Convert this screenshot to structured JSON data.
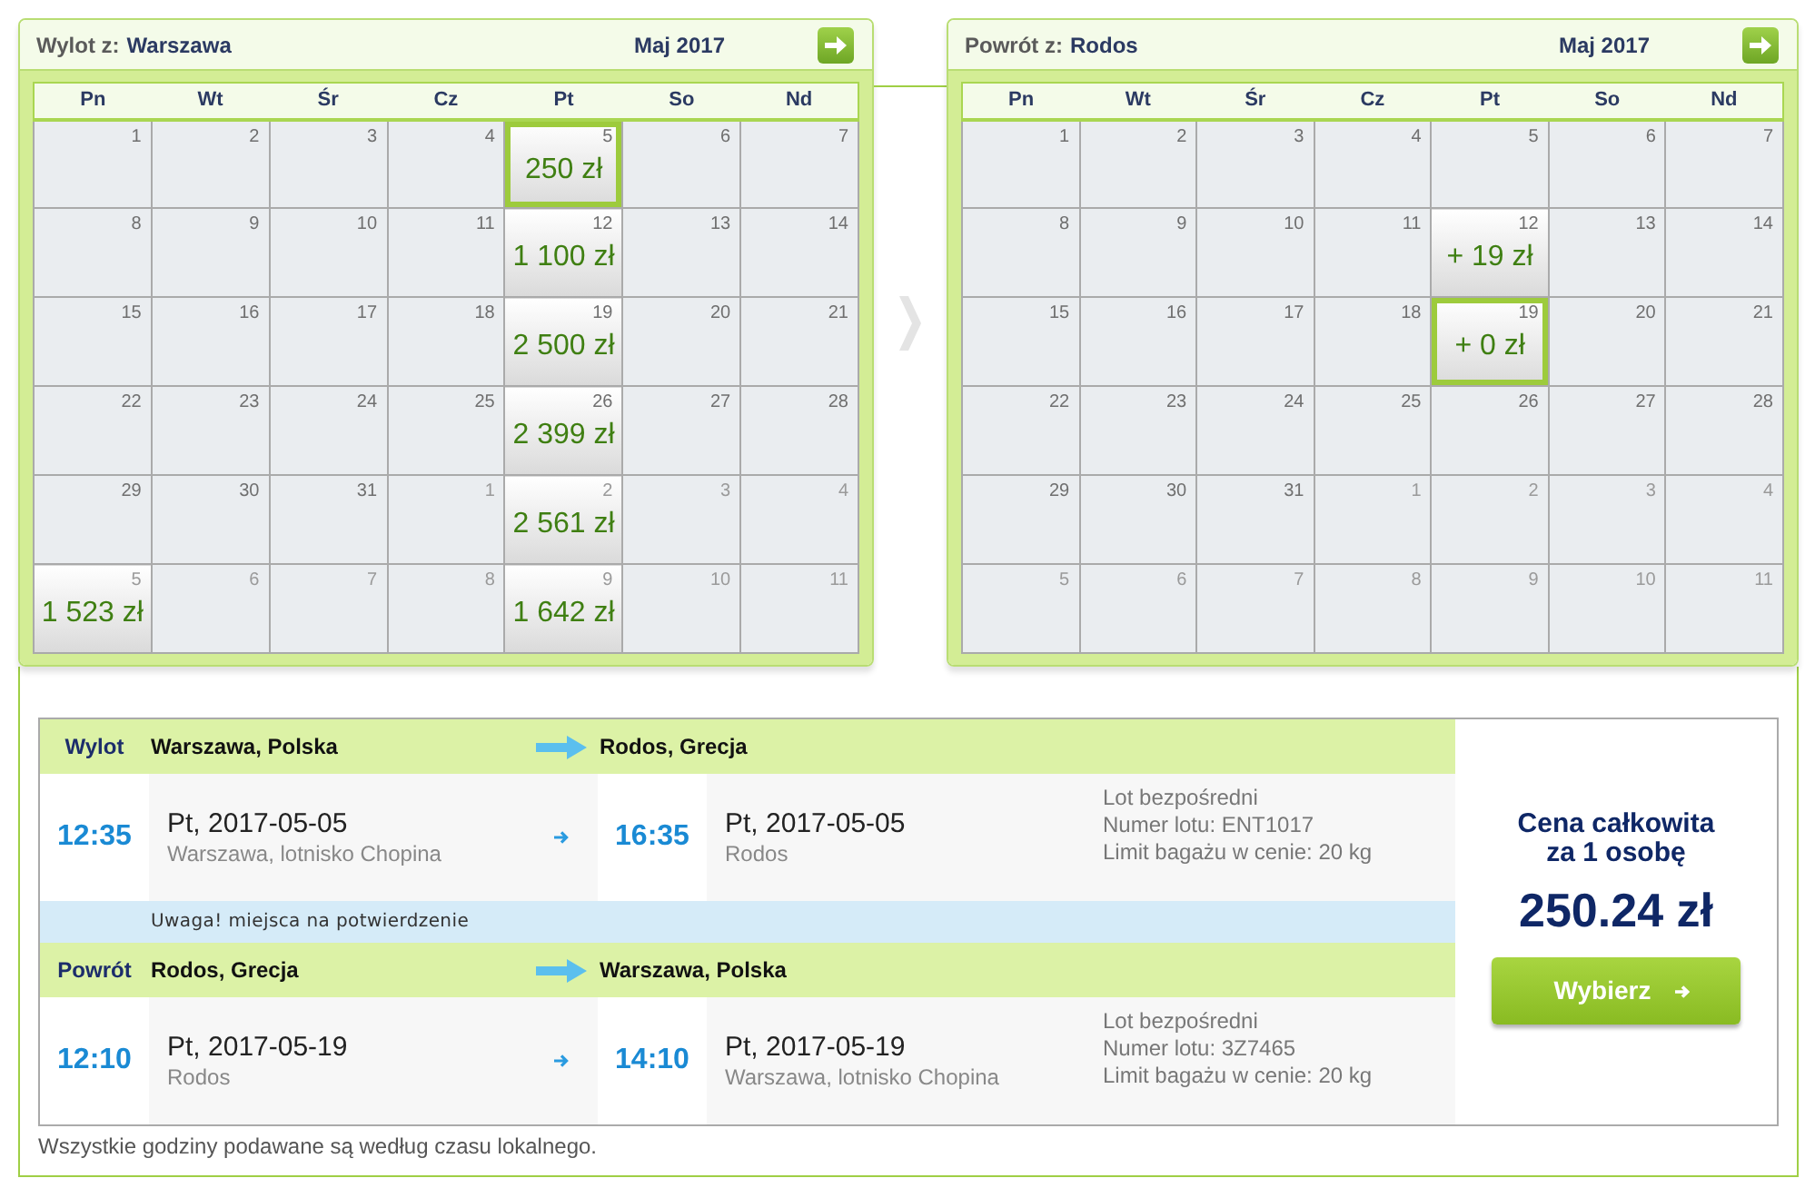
{
  "calendars": [
    {
      "label": "Wylot z:",
      "city": "Warszawa",
      "month": "Maj 2017",
      "weekdays": [
        "Pn",
        "Wt",
        "Śr",
        "Cz",
        "Pt",
        "So",
        "Nd"
      ],
      "weeks": [
        [
          {
            "day": "1",
            "outside": false,
            "selected": false
          },
          {
            "day": "2",
            "outside": false,
            "selected": false
          },
          {
            "day": "3",
            "outside": false,
            "selected": false
          },
          {
            "day": "4",
            "outside": false,
            "selected": false
          },
          {
            "day": "5",
            "outside": false,
            "selected": true,
            "price": "250 zł"
          },
          {
            "day": "6",
            "outside": false,
            "selected": false
          },
          {
            "day": "7",
            "outside": false,
            "selected": false
          }
        ],
        [
          {
            "day": "8",
            "outside": false,
            "selected": false
          },
          {
            "day": "9",
            "outside": false,
            "selected": false
          },
          {
            "day": "10",
            "outside": false,
            "selected": false
          },
          {
            "day": "11",
            "outside": false,
            "selected": false
          },
          {
            "day": "12",
            "outside": false,
            "selected": false,
            "price": "1 100 zł"
          },
          {
            "day": "13",
            "outside": false,
            "selected": false
          },
          {
            "day": "14",
            "outside": false,
            "selected": false
          }
        ],
        [
          {
            "day": "15",
            "outside": false,
            "selected": false
          },
          {
            "day": "16",
            "outside": false,
            "selected": false
          },
          {
            "day": "17",
            "outside": false,
            "selected": false
          },
          {
            "day": "18",
            "outside": false,
            "selected": false
          },
          {
            "day": "19",
            "outside": false,
            "selected": false,
            "price": "2 500 zł"
          },
          {
            "day": "20",
            "outside": false,
            "selected": false
          },
          {
            "day": "21",
            "outside": false,
            "selected": false
          }
        ],
        [
          {
            "day": "22",
            "outside": false,
            "selected": false
          },
          {
            "day": "23",
            "outside": false,
            "selected": false
          },
          {
            "day": "24",
            "outside": false,
            "selected": false
          },
          {
            "day": "25",
            "outside": false,
            "selected": false
          },
          {
            "day": "26",
            "outside": false,
            "selected": false,
            "price": "2 399 zł"
          },
          {
            "day": "27",
            "outside": false,
            "selected": false
          },
          {
            "day": "28",
            "outside": false,
            "selected": false
          }
        ],
        [
          {
            "day": "29",
            "outside": false,
            "selected": false
          },
          {
            "day": "30",
            "outside": false,
            "selected": false
          },
          {
            "day": "31",
            "outside": false,
            "selected": false
          },
          {
            "day": "1",
            "outside": true,
            "selected": false
          },
          {
            "day": "2",
            "outside": true,
            "selected": false,
            "price": "2 561 zł"
          },
          {
            "day": "3",
            "outside": true,
            "selected": false
          },
          {
            "day": "4",
            "outside": true,
            "selected": false
          }
        ],
        [
          {
            "day": "5",
            "outside": true,
            "selected": false,
            "price": "1 523 zł"
          },
          {
            "day": "6",
            "outside": true,
            "selected": false
          },
          {
            "day": "7",
            "outside": true,
            "selected": false
          },
          {
            "day": "8",
            "outside": true,
            "selected": false
          },
          {
            "day": "9",
            "outside": true,
            "selected": false,
            "price": "1 642 zł"
          },
          {
            "day": "10",
            "outside": true,
            "selected": false
          },
          {
            "day": "11",
            "outside": true,
            "selected": false
          }
        ]
      ]
    },
    {
      "label": "Powrót z:",
      "city": "Rodos",
      "month": "Maj 2017",
      "weekdays": [
        "Pn",
        "Wt",
        "Śr",
        "Cz",
        "Pt",
        "So",
        "Nd"
      ],
      "weeks": [
        [
          {
            "day": "1",
            "outside": false,
            "selected": false
          },
          {
            "day": "2",
            "outside": false,
            "selected": false
          },
          {
            "day": "3",
            "outside": false,
            "selected": false
          },
          {
            "day": "4",
            "outside": false,
            "selected": false
          },
          {
            "day": "5",
            "outside": false,
            "selected": false
          },
          {
            "day": "6",
            "outside": false,
            "selected": false
          },
          {
            "day": "7",
            "outside": false,
            "selected": false
          }
        ],
        [
          {
            "day": "8",
            "outside": false,
            "selected": false
          },
          {
            "day": "9",
            "outside": false,
            "selected": false
          },
          {
            "day": "10",
            "outside": false,
            "selected": false
          },
          {
            "day": "11",
            "outside": false,
            "selected": false
          },
          {
            "day": "12",
            "outside": false,
            "selected": false,
            "price": "+ 19 zł"
          },
          {
            "day": "13",
            "outside": false,
            "selected": false
          },
          {
            "day": "14",
            "outside": false,
            "selected": false
          }
        ],
        [
          {
            "day": "15",
            "outside": false,
            "selected": false
          },
          {
            "day": "16",
            "outside": false,
            "selected": false
          },
          {
            "day": "17",
            "outside": false,
            "selected": false
          },
          {
            "day": "18",
            "outside": false,
            "selected": false
          },
          {
            "day": "19",
            "outside": false,
            "selected": true,
            "price": "+ 0 zł"
          },
          {
            "day": "20",
            "outside": false,
            "selected": false
          },
          {
            "day": "21",
            "outside": false,
            "selected": false
          }
        ],
        [
          {
            "day": "22",
            "outside": false,
            "selected": false
          },
          {
            "day": "23",
            "outside": false,
            "selected": false
          },
          {
            "day": "24",
            "outside": false,
            "selected": false
          },
          {
            "day": "25",
            "outside": false,
            "selected": false
          },
          {
            "day": "26",
            "outside": false,
            "selected": false
          },
          {
            "day": "27",
            "outside": false,
            "selected": false
          },
          {
            "day": "28",
            "outside": false,
            "selected": false
          }
        ],
        [
          {
            "day": "29",
            "outside": false,
            "selected": false
          },
          {
            "day": "30",
            "outside": false,
            "selected": false
          },
          {
            "day": "31",
            "outside": false,
            "selected": false
          },
          {
            "day": "1",
            "outside": true,
            "selected": false
          },
          {
            "day": "2",
            "outside": true,
            "selected": false
          },
          {
            "day": "3",
            "outside": true,
            "selected": false
          },
          {
            "day": "4",
            "outside": true,
            "selected": false
          }
        ],
        [
          {
            "day": "5",
            "outside": true,
            "selected": false
          },
          {
            "day": "6",
            "outside": true,
            "selected": false
          },
          {
            "day": "7",
            "outside": true,
            "selected": false
          },
          {
            "day": "8",
            "outside": true,
            "selected": false
          },
          {
            "day": "9",
            "outside": true,
            "selected": false
          },
          {
            "day": "10",
            "outside": true,
            "selected": false
          },
          {
            "day": "11",
            "outside": true,
            "selected": false
          }
        ]
      ]
    }
  ],
  "itinerary": {
    "rows": [
      {
        "kind": "flight",
        "direction": "Wylot",
        "from": "Warszawa, Polska",
        "to": "Rodos, Grecja",
        "departure": {
          "time": "12:35",
          "date": "Pt, 2017-05-05",
          "place": "Warszawa, lotnisko Chopina"
        },
        "arrival": {
          "time": "16:35",
          "date": "Pt, 2017-05-05",
          "place": "Rodos"
        },
        "details": [
          "Lot bezpośredni",
          "Numer lotu: ENT1017",
          "Limit bagażu w cenie: 20 kg"
        ]
      },
      {
        "kind": "notice",
        "text": "Uwaga! miejsca na potwierdzenie"
      },
      {
        "kind": "flight",
        "direction": "Powrót",
        "from": "Rodos, Grecja",
        "to": "Warszawa, Polska",
        "departure": {
          "time": "12:10",
          "date": "Pt, 2017-05-19",
          "place": "Rodos"
        },
        "arrival": {
          "time": "14:10",
          "date": "Pt, 2017-05-19",
          "place": "Warszawa, lotnisko Chopina"
        },
        "details": [
          "Lot bezpośredni",
          "Numer lotu: 3Z7465",
          "Limit bagażu w cenie: 20 kg"
        ]
      }
    ],
    "price": {
      "label": "Cena całkowita za 1 osobę",
      "amount": "250.24 zł",
      "button": "Wybierz"
    }
  },
  "footnote": "Wszystkie godziny podawane są według czasu lokalnego."
}
